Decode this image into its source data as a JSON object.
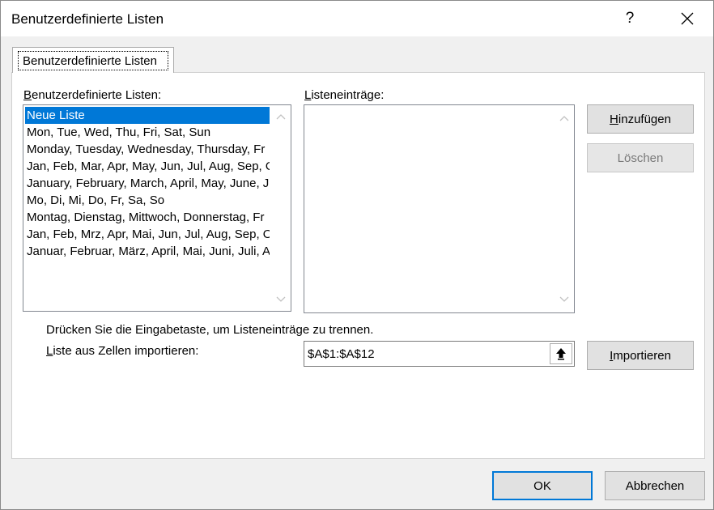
{
  "window": {
    "title": "Benutzerdefinierte Listen",
    "help_label": "?"
  },
  "tab": {
    "label": "Benutzerdefinierte Listen"
  },
  "custom_lists": {
    "label_mnemonic": "B",
    "label_rest": "enutzerdefinierte Listen:",
    "items": [
      "Neue Liste",
      "Mon, Tue, Wed, Thu, Fri, Sat, Sun",
      "Monday, Tuesday, Wednesday, Thursday, Fr",
      "Jan, Feb, Mar, Apr, May, Jun, Jul, Aug, Sep, O",
      "January, February, March, April, May, June, J",
      "Mo, Di, Mi, Do, Fr, Sa, So",
      "Montag, Dienstag, Mittwoch, Donnerstag, Fr",
      "Jan, Feb, Mrz, Apr, Mai, Jun, Jul, Aug, Sep, O",
      "Januar, Februar, März, April, Mai, Juni, Juli, A"
    ],
    "selected_index": 0
  },
  "list_entries": {
    "label_mnemonic": "L",
    "label_rest": "isteneinträge:"
  },
  "buttons": {
    "add_mnemonic": "H",
    "add_rest": "inzufügen",
    "delete_label": "Löschen",
    "import_mnemonic": "I",
    "import_rest": "mportieren",
    "ok_label": "OK",
    "cancel_label": "Abbrechen"
  },
  "hint_text": "Drücken Sie die Eingabetaste, um Listeneinträge zu trennen.",
  "import_row": {
    "label_mnemonic": "L",
    "label_rest": "iste aus Zellen importieren:",
    "value": "$A$1:$A$12"
  },
  "colors": {
    "selection": "#0078d7",
    "default_button_border": "#0078d7"
  }
}
